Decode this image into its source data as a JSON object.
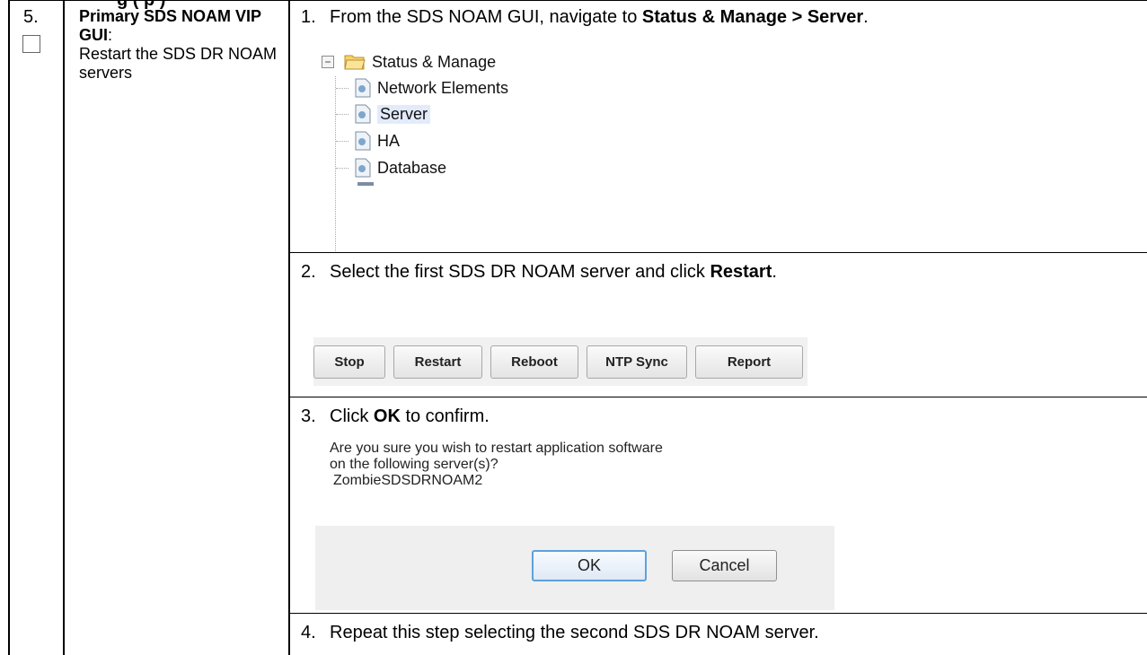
{
  "header_fragment": "g                                          (  p   )",
  "step": {
    "number": "5.",
    "title_bold": "Primary SDS NOAM VIP GUI",
    "title_colon": ":",
    "description": "Restart the SDS DR NOAM servers"
  },
  "substeps": [
    {
      "num": "1.",
      "pre": "From the SDS NOAM GUI, navigate to ",
      "bold": "Status & Manage > Server",
      "post": "."
    },
    {
      "num": "2.",
      "pre": "Select the first SDS DR NOAM server and click ",
      "bold": "Restart",
      "post": "."
    },
    {
      "num": "3.",
      "pre": "Click ",
      "bold": "OK",
      "post": " to confirm."
    },
    {
      "num": "4.",
      "pre": "Repeat this step selecting the second SDS DR NOAM server.",
      "bold": "",
      "post": ""
    }
  ],
  "tree": {
    "expander": "−",
    "root": "Status & Manage",
    "children": [
      "Network Elements",
      "Server",
      "HA",
      "Database"
    ],
    "selected": "Server"
  },
  "toolbar_buttons": [
    "Stop",
    "Restart",
    "Reboot",
    "NTP Sync",
    "Report"
  ],
  "dialog": {
    "line1": "Are you sure you wish to restart application software",
    "line2": "on the following server(s)?",
    "server": "ZombieSDSDRNOAM2",
    "ok": "OK",
    "cancel": "Cancel"
  },
  "colors": {
    "selection": "#e3ebfb",
    "ok_border": "#5ea2da",
    "folder": "#e8c04a"
  }
}
